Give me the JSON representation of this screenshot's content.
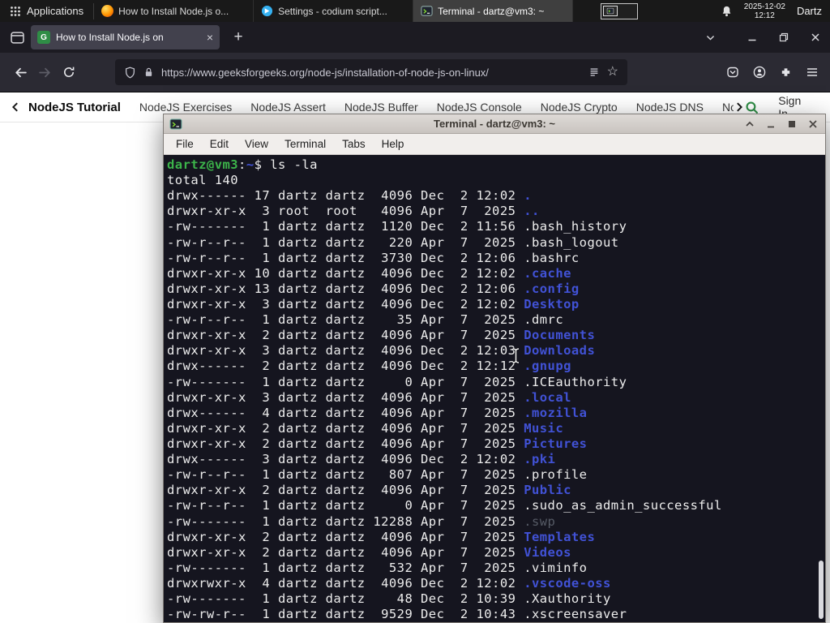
{
  "panel": {
    "applications": "Applications",
    "tasks": [
      {
        "label": "How to Install Node.js o..."
      },
      {
        "label": "Settings - codium script..."
      },
      {
        "label": "Terminal - dartz@vm3: ~"
      }
    ],
    "clock_date": "2025-12-02",
    "clock_time": "12:12",
    "user": "Dartz"
  },
  "browser": {
    "tab_title": "How to Install Node.js on",
    "url": "https://www.geeksforgeeks.org/node-js/installation-of-node-js-on-linux/"
  },
  "site_nav": {
    "links": [
      "NodeJS Tutorial",
      "NodeJS Exercises",
      "NodeJS Assert",
      "NodeJS Buffer",
      "NodeJS Console",
      "NodeJS Crypto",
      "NodeJS DNS",
      "Node"
    ],
    "sign_in": "Sign In"
  },
  "terminal": {
    "title": "Terminal - dartz@vm3: ~",
    "menus": [
      "File",
      "Edit",
      "View",
      "Terminal",
      "Tabs",
      "Help"
    ],
    "prompt": {
      "user_host": "dartz@vm3",
      "colon": ":",
      "path": "~",
      "dollar": "$",
      "command": " ls -la"
    },
    "total_line": "total 140",
    "listing": [
      {
        "pre": "drwx------ 17 dartz dartz  4096 Dec  2 12:02 ",
        "name": ".",
        "type": "dir"
      },
      {
        "pre": "drwxr-xr-x  3 root  root   4096 Apr  7  2025 ",
        "name": "..",
        "type": "dir"
      },
      {
        "pre": "-rw-------  1 dartz dartz  1120 Dec  2 11:56 ",
        "name": ".bash_history",
        "type": "file"
      },
      {
        "pre": "-rw-r--r--  1 dartz dartz   220 Apr  7  2025 ",
        "name": ".bash_logout",
        "type": "file"
      },
      {
        "pre": "-rw-r--r--  1 dartz dartz  3730 Dec  2 12:06 ",
        "name": ".bashrc",
        "type": "file"
      },
      {
        "pre": "drwxr-xr-x 10 dartz dartz  4096 Dec  2 12:02 ",
        "name": ".cache",
        "type": "dir"
      },
      {
        "pre": "drwxr-xr-x 13 dartz dartz  4096 Dec  2 12:06 ",
        "name": ".config",
        "type": "dir"
      },
      {
        "pre": "drwxr-xr-x  3 dartz dartz  4096 Dec  2 12:02 ",
        "name": "Desktop",
        "type": "dir"
      },
      {
        "pre": "-rw-r--r--  1 dartz dartz    35 Apr  7  2025 ",
        "name": ".dmrc",
        "type": "file"
      },
      {
        "pre": "drwxr-xr-x  2 dartz dartz  4096 Apr  7  2025 ",
        "name": "Documents",
        "type": "dir"
      },
      {
        "pre": "drwxr-xr-x  3 dartz dartz  4096 Dec  2 12:03 ",
        "name": "Downloads",
        "type": "dir"
      },
      {
        "pre": "drwx------  2 dartz dartz  4096 Dec  2 12:12 ",
        "name": ".gnupg",
        "type": "dir"
      },
      {
        "pre": "-rw-------  1 dartz dartz     0 Apr  7  2025 ",
        "name": ".ICEauthority",
        "type": "file"
      },
      {
        "pre": "drwxr-xr-x  3 dartz dartz  4096 Apr  7  2025 ",
        "name": ".local",
        "type": "dir"
      },
      {
        "pre": "drwx------  4 dartz dartz  4096 Apr  7  2025 ",
        "name": ".mozilla",
        "type": "dir"
      },
      {
        "pre": "drwxr-xr-x  2 dartz dartz  4096 Apr  7  2025 ",
        "name": "Music",
        "type": "dir"
      },
      {
        "pre": "drwxr-xr-x  2 dartz dartz  4096 Apr  7  2025 ",
        "name": "Pictures",
        "type": "dir"
      },
      {
        "pre": "drwx------  3 dartz dartz  4096 Dec  2 12:02 ",
        "name": ".pki",
        "type": "dir"
      },
      {
        "pre": "-rw-r--r--  1 dartz dartz   807 Apr  7  2025 ",
        "name": ".profile",
        "type": "file"
      },
      {
        "pre": "drwxr-xr-x  2 dartz dartz  4096 Apr  7  2025 ",
        "name": "Public",
        "type": "dir"
      },
      {
        "pre": "-rw-r--r--  1 dartz dartz     0 Apr  7  2025 ",
        "name": ".sudo_as_admin_successful",
        "type": "file"
      },
      {
        "pre": "-rw-------  1 dartz dartz 12288 Apr  7  2025 ",
        "name": ".swp",
        "type": "dim"
      },
      {
        "pre": "drwxr-xr-x  2 dartz dartz  4096 Apr  7  2025 ",
        "name": "Templates",
        "type": "dir"
      },
      {
        "pre": "drwxr-xr-x  2 dartz dartz  4096 Apr  7  2025 ",
        "name": "Videos",
        "type": "dir"
      },
      {
        "pre": "-rw-------  1 dartz dartz   532 Apr  7  2025 ",
        "name": ".viminfo",
        "type": "file"
      },
      {
        "pre": "drwxrwxr-x  4 dartz dartz  4096 Dec  2 12:02 ",
        "name": ".vscode-oss",
        "type": "dir"
      },
      {
        "pre": "-rw-------  1 dartz dartz    48 Dec  2 10:39 ",
        "name": ".Xauthority",
        "type": "file"
      },
      {
        "pre": "-rw-rw-r--  1 dartz dartz  9529 Dec  2 10:43 ",
        "name": ".xscreensaver",
        "type": "file"
      }
    ]
  },
  "colors": {
    "gfg_green": "#2f8d46",
    "terminal_background": "#15151f",
    "terminal_dir_blue": "#4152d6",
    "terminal_prompt_green": "#3cb44a",
    "firefox_dark_toolbar": "#2b2a33"
  },
  "icons": [
    "applications-grid",
    "firefox",
    "codium",
    "terminal",
    "workspace-switcher",
    "bell",
    "firefox-view",
    "site-favicon",
    "tab-close",
    "new-tab",
    "tab-list-chevron",
    "window-minimize",
    "window-restore",
    "window-close",
    "back-arrow",
    "forward-arrow",
    "reload",
    "tracking-shield",
    "lock",
    "reader-view",
    "bookmark-star",
    "pocket",
    "account",
    "extensions",
    "menu-hamburger",
    "nav-chevron-left",
    "nav-chevron-right",
    "search-magnifier",
    "shade-chevron-up",
    "maximize-square",
    "text-cursor"
  ]
}
